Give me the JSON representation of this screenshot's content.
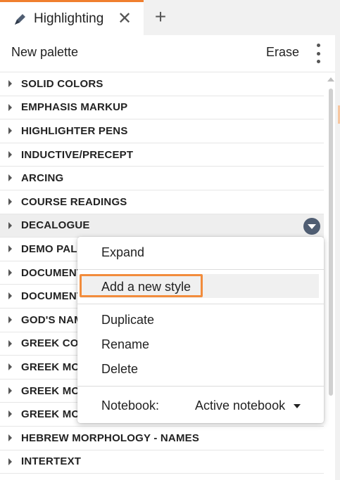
{
  "tab": {
    "title": "Highlighting",
    "close_glyph": "✕",
    "add_glyph": "+"
  },
  "toolbar": {
    "new_palette": "New palette",
    "erase": "Erase"
  },
  "palettes": [
    "SOLID COLORS",
    "EMPHASIS MARKUP",
    "HIGHLIGHTER PENS",
    "INDUCTIVE/PRECEPT",
    "ARCING",
    "COURSE READINGS",
    "DECALOGUE",
    "DEMO PALE",
    "DOCUMENT",
    "DOCUMENT",
    "GOD'S NAM",
    "GREEK CON",
    "GREEK MOI",
    "GREEK MOI",
    "GREEK MOI",
    "HEBREW MORPHOLOGY - NAMES",
    "INTERTEXT"
  ],
  "context_menu": {
    "expand": "Expand",
    "add_style": "Add a new style",
    "duplicate": "Duplicate",
    "rename": "Rename",
    "delete": "Delete",
    "notebook_label": "Notebook:",
    "notebook_value": "Active notebook"
  },
  "colors": {
    "accent": "#f07f2e",
    "dropdown_button": "#4f5d72"
  },
  "icons": {
    "tab": "highlighter-pen-icon",
    "more": "kebab-menu-icon"
  }
}
